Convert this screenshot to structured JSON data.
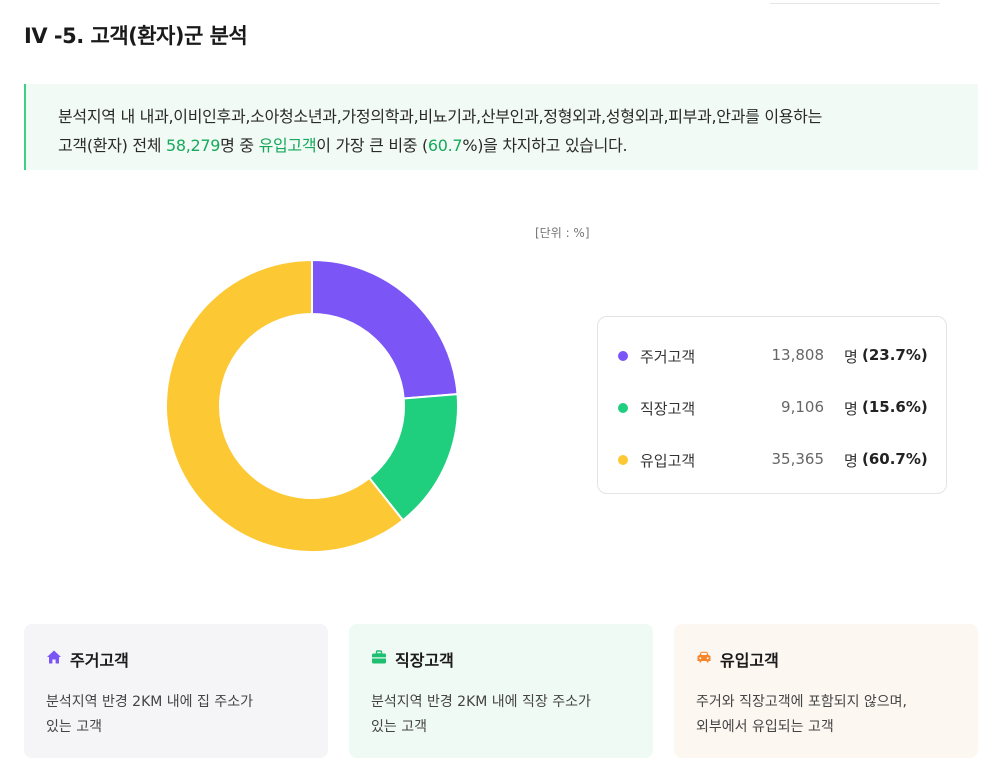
{
  "page_title": "IV -5. 고객(환자)군 분석",
  "summary": {
    "line1": "분석지역 내 내과,이비인후과,소아청소년과,가정의학과,비뇨기과,산부인과,정형외과,성형외과,피부과,안과를 이용하는",
    "line2_a": "고객(환자) 전체 ",
    "total": "58,279",
    "line2_b": "명 중 ",
    "top_group": "유입고객",
    "line2_c": "이 가장 큰 비중 (",
    "top_pct": "60.7",
    "line2_d": "%)을 차지하고 있습니다."
  },
  "unit_label": "[단위 : %]",
  "legend": [
    {
      "name": "주거고객",
      "count": "13,808",
      "unit": "명",
      "pct": "(23.7%)",
      "color": "#7b55f6"
    },
    {
      "name": "직장고객",
      "count": "9,106",
      "unit": "명",
      "pct": "(15.6%)",
      "color": "#1fcf7e"
    },
    {
      "name": "유입고객",
      "count": "35,365",
      "unit": "명",
      "pct": "(60.7%)",
      "color": "#fcc834"
    }
  ],
  "chart_data": {
    "type": "pie",
    "categories": [
      "주거고객",
      "직장고객",
      "유입고객"
    ],
    "values": [
      23.7,
      15.6,
      60.7
    ],
    "counts": [
      13808,
      9106,
      35365
    ],
    "colors": [
      "#7b55f6",
      "#1fcf7e",
      "#fcc834"
    ],
    "unit": "%",
    "donut": true
  },
  "cards": [
    {
      "icon": "home-icon",
      "title": "주거고객",
      "text_line1": "분석지역 반경 2KM 내에 집 주소가",
      "text_line2": "있는 고객",
      "color": "#7b55f6"
    },
    {
      "icon": "briefcase-icon",
      "title": "직장고객",
      "text_line1": "분석지역 반경 2KM 내에 직장 주소가",
      "text_line2": "있는 고객",
      "color": "#1fbf70"
    },
    {
      "icon": "car-icon",
      "title": "유입고객",
      "text_line1": "주거와 직장고객에 포함되지 않으며,",
      "text_line2": "외부에서 유입되는 고객",
      "color": "#f5862b"
    }
  ]
}
